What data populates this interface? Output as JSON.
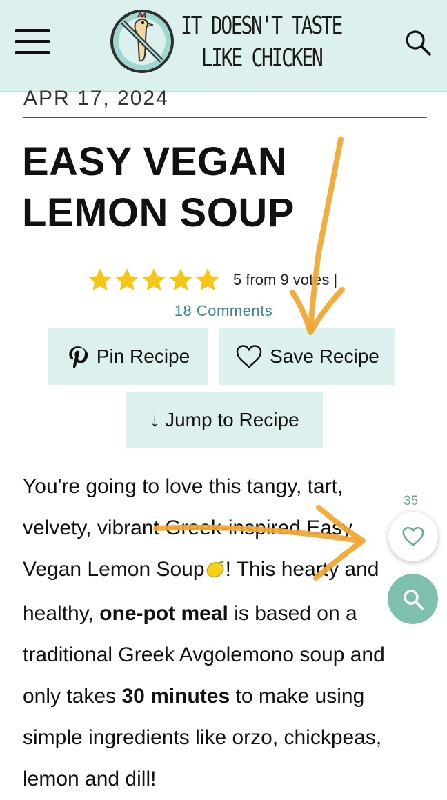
{
  "header": {
    "logo_line1": "IT DOESN'T TASTE",
    "logo_line2": "LIKE CHICKEN"
  },
  "post": {
    "date": "APR 17, 2024",
    "title_line1": "EASY VEGAN",
    "title_line2": "LEMON SOUP",
    "rating": 5,
    "rating_text": "5 from 9 votes |",
    "comments": "18 Comments"
  },
  "buttons": {
    "pin": "Pin Recipe",
    "save": "Save Recipe",
    "jump": "↓ Jump to Recipe"
  },
  "body": {
    "p1": "You're going to love this tangy, tart, velvety, vibrant Greek-inspired Easy Vegan Lemon Soup",
    "p2": "! This hearty and healthy, ",
    "b1": "one-pot meal",
    "p3": " is based on a traditional Greek Avgolemono soup and only takes ",
    "b2": "30 minutes",
    "p4": " to make using simple ingredients like orzo, chickpeas, lemon and dill!"
  },
  "favorites": {
    "count": "35"
  },
  "colors": {
    "header_bg": "#dcf1ee",
    "accent": "#3e8a7e",
    "star": "#f5c518",
    "arrow": "#f0a630",
    "fab": "#7fbfaf"
  }
}
